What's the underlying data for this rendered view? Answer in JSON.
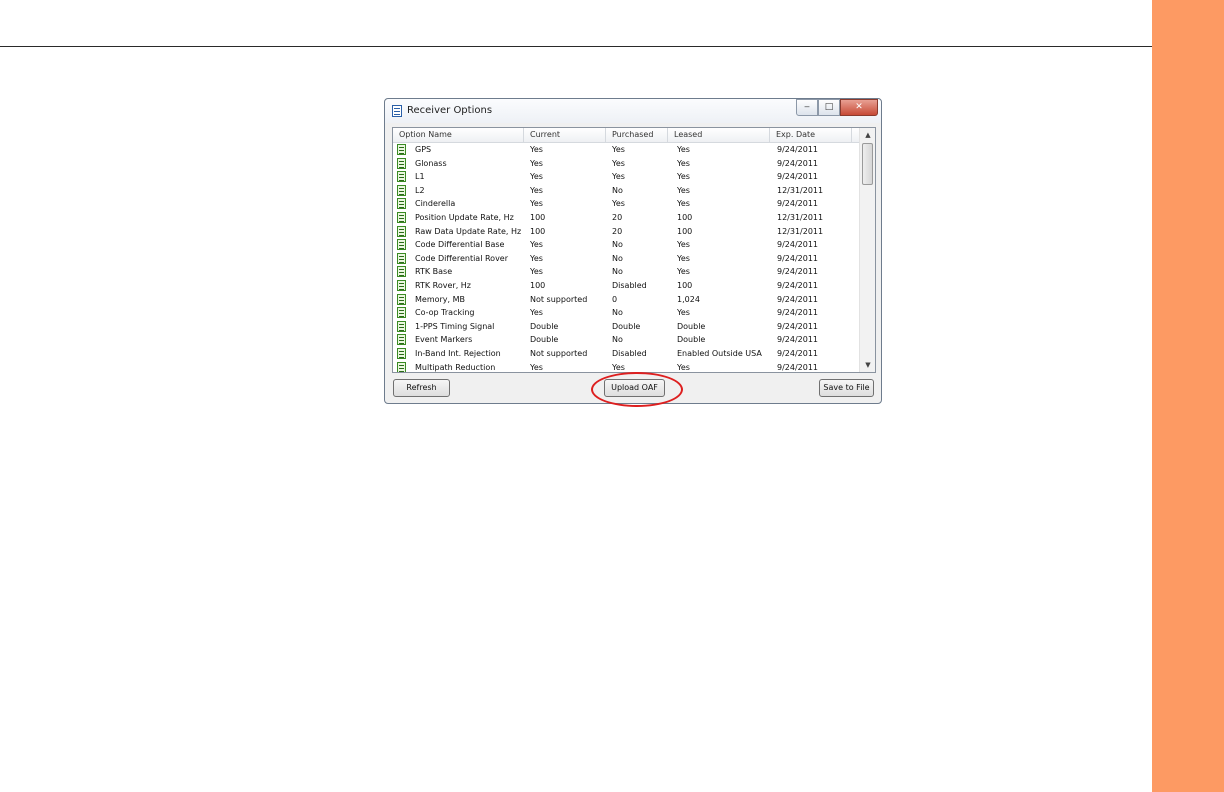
{
  "window": {
    "title": "Receiver Options",
    "controls": {
      "minimize": "‒",
      "maximize": "□",
      "close": "✕"
    }
  },
  "table": {
    "columns": [
      "Option Name",
      "Current",
      "Purchased",
      "Leased",
      "Exp. Date"
    ],
    "rows": [
      [
        "GPS",
        "Yes",
        "Yes",
        "Yes",
        "9/24/2011"
      ],
      [
        "Glonass",
        "Yes",
        "Yes",
        "Yes",
        "9/24/2011"
      ],
      [
        "L1",
        "Yes",
        "Yes",
        "Yes",
        "9/24/2011"
      ],
      [
        "L2",
        "Yes",
        "No",
        "Yes",
        "12/31/2011"
      ],
      [
        "Cinderella",
        "Yes",
        "Yes",
        "Yes",
        "9/24/2011"
      ],
      [
        "Position Update Rate, Hz",
        "100",
        "20",
        "100",
        "12/31/2011"
      ],
      [
        "Raw Data Update Rate, Hz",
        "100",
        "20",
        "100",
        "12/31/2011"
      ],
      [
        "Code Differential Base",
        "Yes",
        "No",
        "Yes",
        "9/24/2011"
      ],
      [
        "Code Differential Rover",
        "Yes",
        "No",
        "Yes",
        "9/24/2011"
      ],
      [
        "RTK Base",
        "Yes",
        "No",
        "Yes",
        "9/24/2011"
      ],
      [
        "RTK Rover, Hz",
        "100",
        "Disabled",
        "100",
        "9/24/2011"
      ],
      [
        "Memory, MB",
        "Not supported",
        "0",
        "1,024",
        "9/24/2011"
      ],
      [
        "Co-op Tracking",
        "Yes",
        "No",
        "Yes",
        "9/24/2011"
      ],
      [
        "1-PPS Timing Signal",
        "Double",
        "Double",
        "Double",
        "9/24/2011"
      ],
      [
        "Event Markers",
        "Double",
        "No",
        "Double",
        "9/24/2011"
      ],
      [
        "In-Band Int. Rejection",
        "Not supported",
        "Disabled",
        "Enabled Outside USA",
        "9/24/2011"
      ],
      [
        "Multipath Reduction",
        "Yes",
        "Yes",
        "Yes",
        "9/24/2011"
      ]
    ]
  },
  "scrollbar": {
    "up_arrow": "▲",
    "down_arrow": "▼"
  },
  "buttons": {
    "refresh": "Refresh",
    "upload": "Upload OAF",
    "save": "Save to File"
  },
  "colors": {
    "side_band": "#fd9a63",
    "highlight": "#dd1f1f"
  },
  "icons": {
    "app": "list-window-icon",
    "row": "option-doc-icon"
  }
}
